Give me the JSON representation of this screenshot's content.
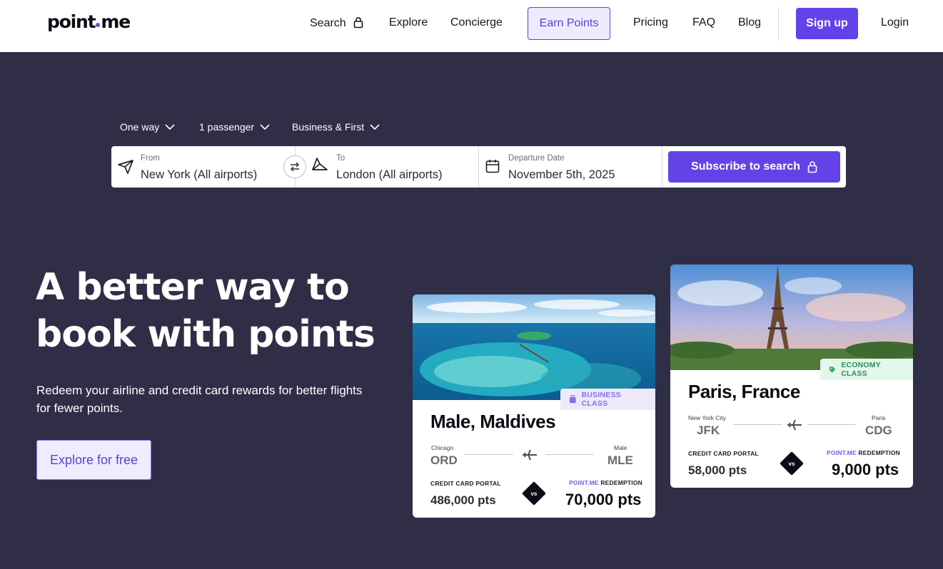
{
  "header": {
    "logo_left": "point",
    "logo_right": "me",
    "nav": {
      "search": "Search",
      "explore": "Explore",
      "concierge": "Concierge",
      "earn_points": "Earn Points",
      "pricing": "Pricing",
      "faq": "FAQ",
      "blog": "Blog",
      "signup": "Sign up",
      "login": "Login"
    }
  },
  "search": {
    "trip_type": "One way",
    "passengers": "1 passenger",
    "cabin": "Business & First",
    "from_label": "From",
    "from_value": "New York (All airports)",
    "to_label": "To",
    "to_value": "London (All airports)",
    "date_label": "Departure Date",
    "date_value": "November 5th, 2025",
    "subscribe_label": "Subscribe to search"
  },
  "hero": {
    "title_line1": "A better way to",
    "title_line2": "book with points",
    "subtitle": "Redeem your airline and credit card rewards for better flights for fewer points.",
    "cta": "Explore for free"
  },
  "cards": {
    "maldives": {
      "badge": "BUSINESS CLASS",
      "city": "Male, Maldives",
      "origin_city": "Chicago",
      "origin_code": "ORD",
      "dest_city": "Male",
      "dest_code": "MLE",
      "portal_label": "CREDIT CARD PORTAL",
      "portal_pts": "486,000 pts",
      "vs": "vs",
      "redemption_brand": "POINT.ME",
      "redemption_label": "REDEMPTION",
      "redemption_pts": "70,000 pts"
    },
    "paris": {
      "badge": "ECONOMY CLASS",
      "city": "Paris, France",
      "origin_city": "New York City",
      "origin_code": "JFK",
      "dest_city": "Paris",
      "dest_code": "CDG",
      "portal_label": "CREDIT CARD PORTAL",
      "portal_pts": "58,000 pts",
      "vs": "vs",
      "redemption_brand": "POINT.ME",
      "redemption_label": "REDEMPTION",
      "redemption_pts": "9,000 pts"
    }
  },
  "colors": {
    "accent": "#6343e8",
    "background": "#302d47",
    "business_badge": "#ede9fb",
    "economy_badge": "#e3f6ec"
  }
}
